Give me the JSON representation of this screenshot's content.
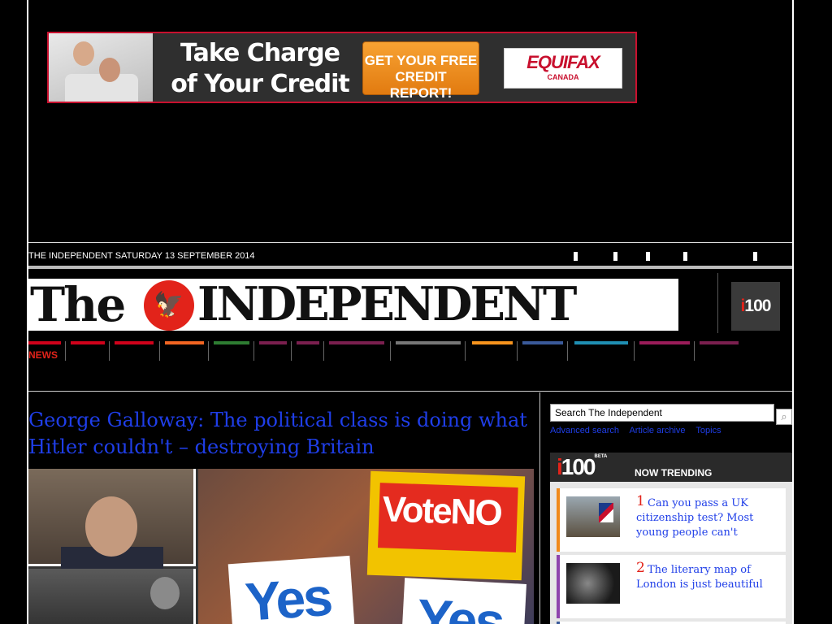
{
  "ad": {
    "headline_line1": "Take Charge",
    "headline_line2": "of Your Credit",
    "cta_line1": "GET YOUR FREE",
    "cta_line2": "CREDIT REPORT!",
    "brand": "EQUIFAX",
    "brand_sub": "CANADA",
    "colors": {
      "border": "#c8102e",
      "cta": "#f08a1c"
    }
  },
  "header": {
    "date_line": "THE INDEPENDENT SATURDAY 13 SEPTEMBER 2014"
  },
  "masthead": {
    "logo_word_the": "The",
    "logo_word_independent": "INDEPENDENT",
    "logo_icon": "eagle-icon",
    "i100_prefix": "i",
    "i100_suffix": "100"
  },
  "nav": {
    "items": [
      {
        "label": "NEWS",
        "color": "#d0021b"
      },
      {
        "label": "",
        "color": "#d0021b"
      },
      {
        "label": "",
        "color": "#d0021b"
      },
      {
        "label": "",
        "color": "#f26522"
      },
      {
        "label": "",
        "color": "#2e7d32"
      },
      {
        "label": "",
        "color": "#7b1f4f"
      },
      {
        "label": "",
        "color": "#7b1f4f"
      },
      {
        "label": "",
        "color": "#7b1f4f"
      },
      {
        "label": "",
        "color": "#777777"
      },
      {
        "label": "",
        "color": "#f7941d"
      },
      {
        "label": "",
        "color": "#3a5a9a"
      },
      {
        "label": "",
        "color": "#1f8fb3"
      },
      {
        "label": "",
        "color": "#9b1c5a"
      },
      {
        "label": "",
        "color": "#7b1f4f"
      }
    ]
  },
  "article": {
    "headline": "George Galloway: The political class is doing what Hitler couldn't – destroying Britain",
    "sign_no": "VoteNO",
    "sign_yes": "Yes"
  },
  "sidebar": {
    "search_placeholder": "Search The Independent",
    "search_icon": "search-icon",
    "links": [
      "Advanced search",
      "Article archive",
      "Topics"
    ],
    "trending": {
      "logo_prefix": "i",
      "logo_suffix": "100",
      "beta": "BETA",
      "title": "NOW TRENDING",
      "items": [
        {
          "rank": "1",
          "title": "Can you pass a UK citizenship test? Most young people can't",
          "accent": "#f08a1c"
        },
        {
          "rank": "2",
          "title": "The literary map of London is just beautiful",
          "accent": "#8e44ad"
        }
      ]
    }
  }
}
